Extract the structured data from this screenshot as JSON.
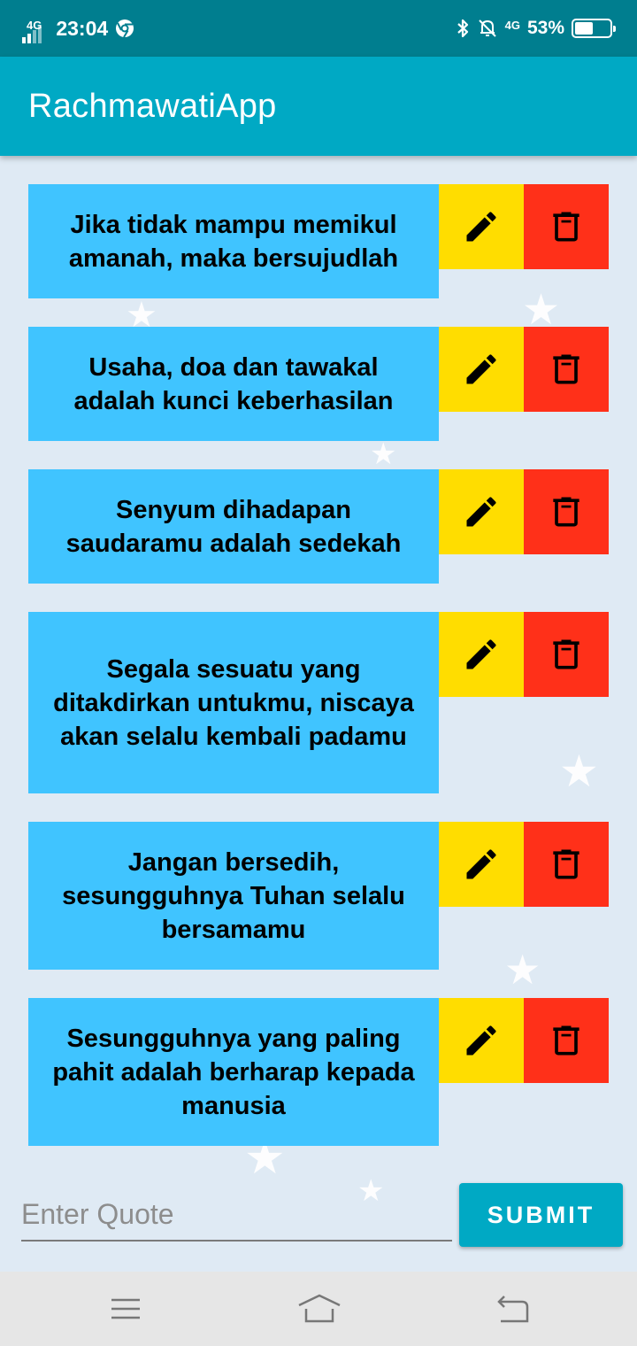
{
  "status_bar": {
    "network_left": "4G",
    "time": "23:04",
    "network_right": "4G",
    "battery_percent": "53%",
    "battery_level": 0.53,
    "icons": [
      "signal-icon",
      "chrome-icon",
      "bluetooth-icon",
      "mute-icon",
      "battery-icon"
    ]
  },
  "app_bar": {
    "title": "RachmawatiApp"
  },
  "quotes": [
    {
      "text": "Jika tidak mampu memikul amanah, maka bersujudlah"
    },
    {
      "text": "Usaha, doa dan tawakal adalah kunci keberhasilan"
    },
    {
      "text": "Senyum dihadapan saudaramu adalah sedekah"
    },
    {
      "text": "Segala sesuatu yang ditakdirkan untukmu, niscaya akan selalu kembali padamu"
    },
    {
      "text": "Jangan bersedih, sesungguhnya Tuhan selalu bersamamu"
    },
    {
      "text": "Sesungguhnya yang paling pahit adalah berharap kepada manusia"
    }
  ],
  "input": {
    "placeholder": "Enter Quote",
    "value": ""
  },
  "submit": {
    "label": "SUBMIT"
  },
  "colors": {
    "status_bar": "#007e8f",
    "app_bar": "#00a9c4",
    "card": "#40c4ff",
    "edit": "#ffdd00",
    "delete": "#ff3019",
    "background": "#dfeaf4"
  },
  "nav": {
    "icons": [
      "menu-icon",
      "home-icon",
      "back-icon"
    ]
  }
}
